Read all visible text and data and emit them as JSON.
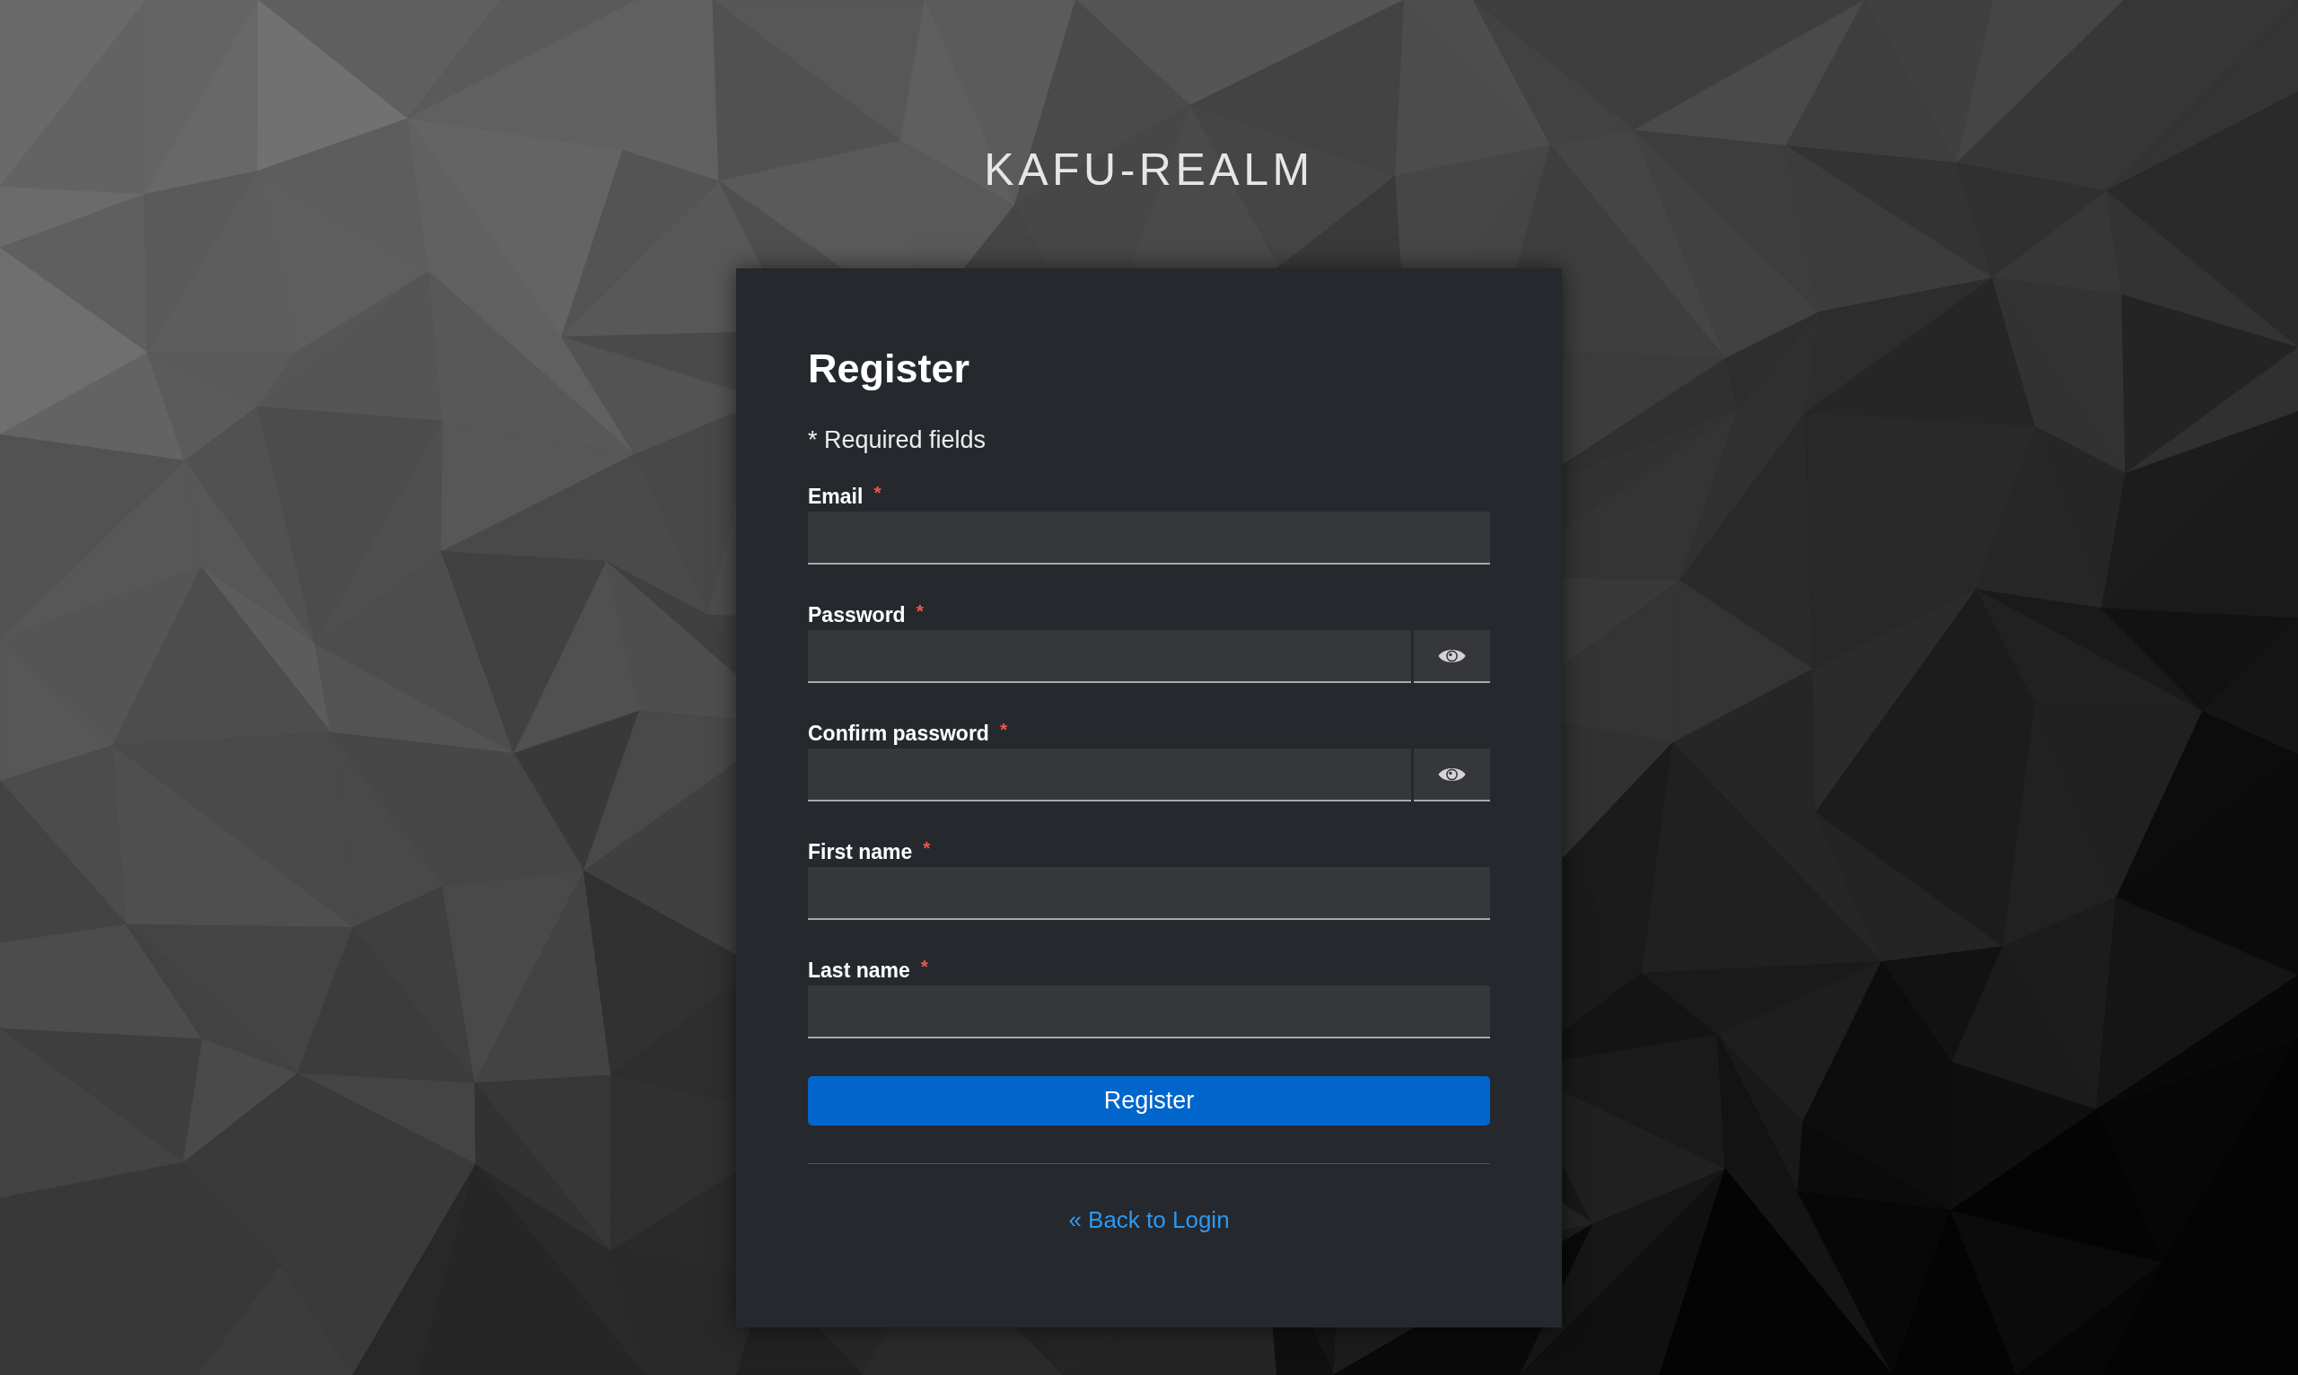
{
  "realm_title": "KAFU-REALM",
  "form": {
    "title": "Register",
    "required_note": "* Required fields",
    "fields": [
      {
        "label": "Email",
        "required_mark": "*",
        "kind": "text"
      },
      {
        "label": "Password",
        "required_mark": "*",
        "kind": "password"
      },
      {
        "label": "Confirm password",
        "required_mark": "*",
        "kind": "password"
      },
      {
        "label": "First name",
        "required_mark": "*",
        "kind": "text"
      },
      {
        "label": "Last name",
        "required_mark": "*",
        "kind": "text"
      }
    ],
    "submit_button": "Register",
    "back_link": "« Back to Login"
  }
}
